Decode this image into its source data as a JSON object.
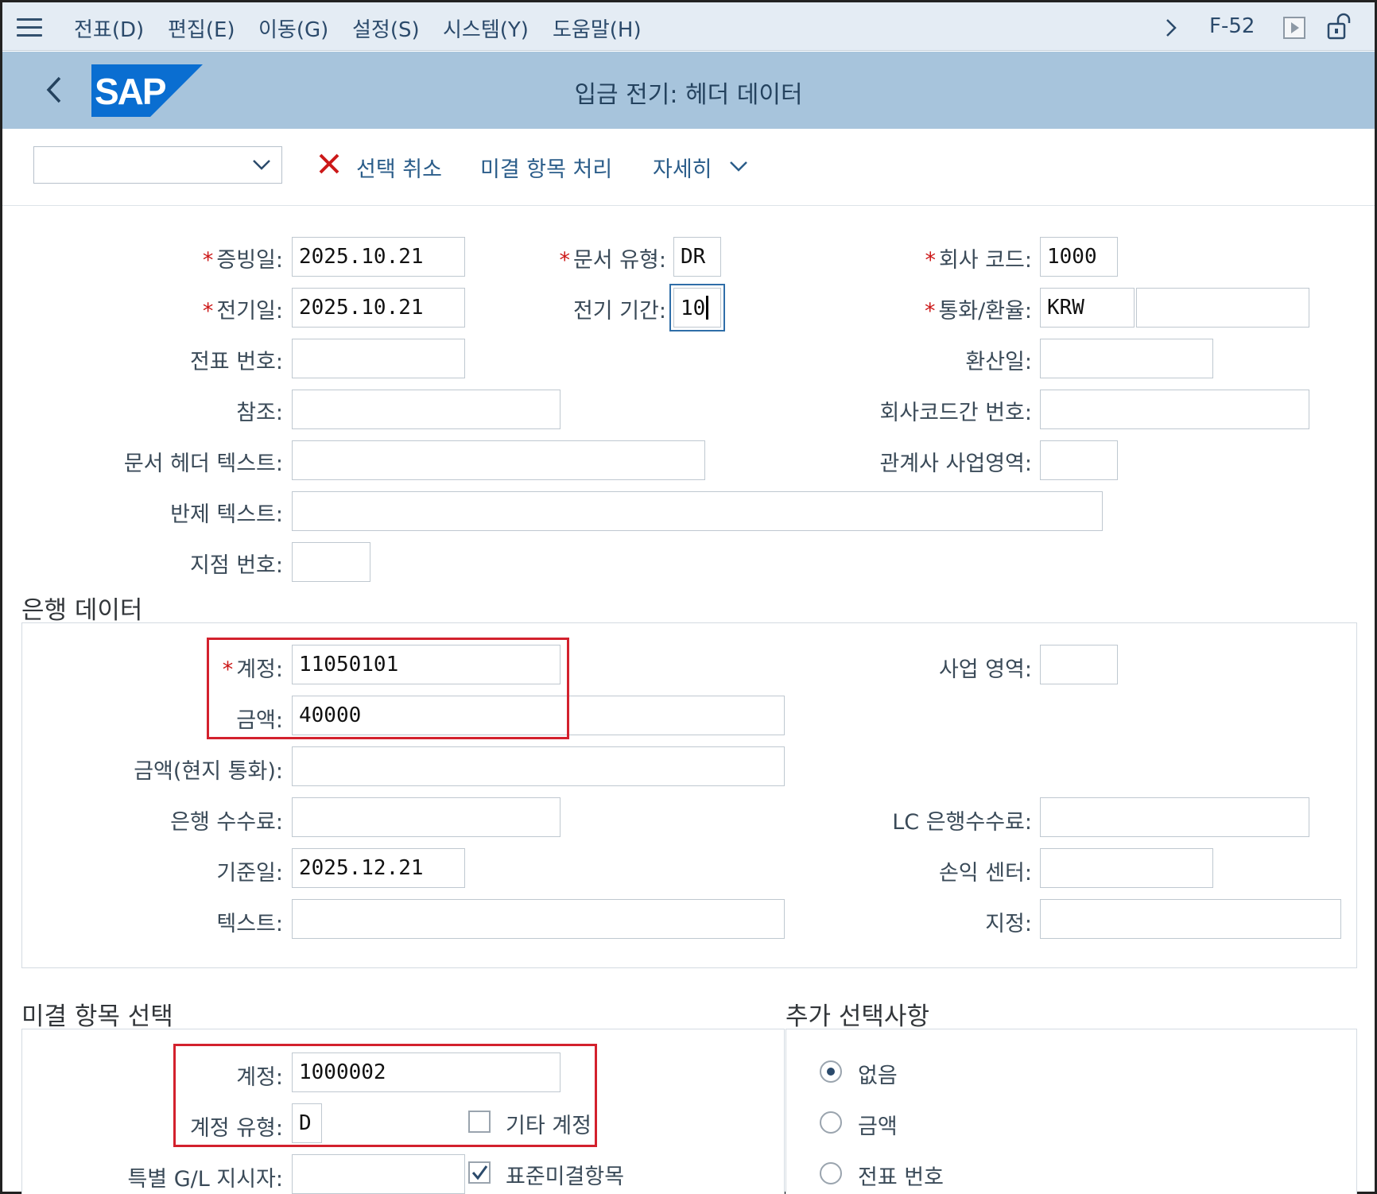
{
  "menu": {
    "items": [
      "전표(D)",
      "편집(E)",
      "이동(G)",
      "설정(S)",
      "시스템(Y)",
      "도움말(H)"
    ],
    "transaction_code": "F-52"
  },
  "header": {
    "logo_text": "SAP",
    "title": "입금 전기: 헤더 데이터"
  },
  "toolbar": {
    "dropdown_value": "",
    "cancel_selection": "선택 취소",
    "process_open_items": "미결 항목 처리",
    "more": "자세히"
  },
  "header_data": {
    "document_date": {
      "label": "증빙일:",
      "value": "2025.10.21",
      "required": true
    },
    "posting_date": {
      "label": "전기일:",
      "value": "2025.10.21",
      "required": true
    },
    "document_number": {
      "label": "전표 번호:",
      "value": ""
    },
    "reference": {
      "label": "참조:",
      "value": ""
    },
    "doc_header_text": {
      "label": "문서 헤더 텍스트:",
      "value": ""
    },
    "clearing_text": {
      "label": "반제 텍스트:",
      "value": ""
    },
    "branch_number": {
      "label": "지점 번호:",
      "value": ""
    },
    "document_type": {
      "label": "문서 유형:",
      "value": "DR",
      "required": true
    },
    "posting_period": {
      "label": "전기 기간:",
      "value": "10"
    },
    "company_code": {
      "label": "회사 코드:",
      "value": "1000",
      "required": true
    },
    "currency_rate": {
      "label": "통화/환율:",
      "currency": "KRW",
      "rate": "",
      "required": true
    },
    "translation_date": {
      "label": "환산일:",
      "value": ""
    },
    "cross_cc_number": {
      "label": "회사코드간 번호:",
      "value": ""
    },
    "trading_partner_ba": {
      "label": "관계사 사업영역:",
      "value": ""
    }
  },
  "bank_data": {
    "section_title": "은행 데이터",
    "account": {
      "label": "계정:",
      "value": "11050101",
      "required": true
    },
    "amount": {
      "label": "금액:",
      "value": "40000"
    },
    "amount_local": {
      "label": "금액(현지 통화):",
      "value": ""
    },
    "bank_charges": {
      "label": "은행 수수료:",
      "value": ""
    },
    "value_date": {
      "label": "기준일:",
      "value": "2025.12.21"
    },
    "text": {
      "label": "텍스트:",
      "value": ""
    },
    "business_area": {
      "label": "사업 영역:",
      "value": ""
    },
    "lc_bank_charges": {
      "label": "LC 은행수수료:",
      "value": ""
    },
    "profit_center": {
      "label": "손익 센터:",
      "value": ""
    },
    "assignment": {
      "label": "지정:",
      "value": ""
    }
  },
  "open_item_selection": {
    "section_title": "미결 항목 선택",
    "account": {
      "label": "계정:",
      "value": "1000002"
    },
    "account_type": {
      "label": "계정 유형:",
      "value": "D"
    },
    "other_accounts": {
      "label": "기타 계정",
      "checked": false
    },
    "special_gl": {
      "label": "특별 G/L 지시자:",
      "value": ""
    },
    "standard_oi": {
      "label": "표준미결항목",
      "checked": true
    }
  },
  "additional_selections": {
    "section_title": "추가 선택사항",
    "options": [
      {
        "label": "없음",
        "selected": true
      },
      {
        "label": "금액",
        "selected": false
      },
      {
        "label": "전표 번호",
        "selected": false
      }
    ]
  },
  "colors": {
    "menubar_bg": "#e4ecf4",
    "titlebar_bg": "#a7c4dc",
    "required_star": "#cc1919",
    "highlight_box": "#d3212d",
    "sap_blue": "#0a6ed1"
  }
}
